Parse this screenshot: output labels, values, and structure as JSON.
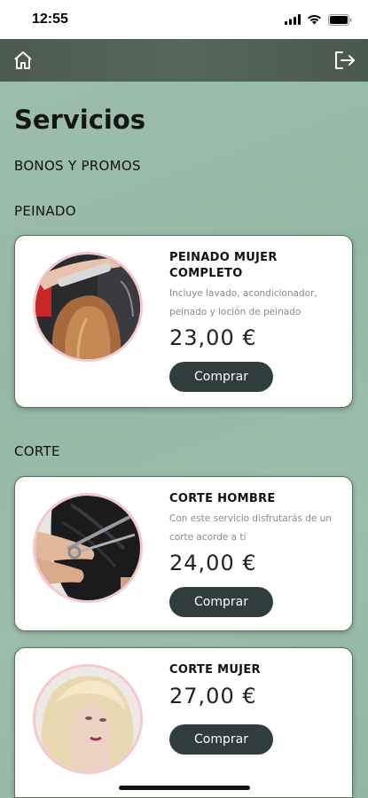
{
  "status": {
    "time": "12:55"
  },
  "page": {
    "title": "Servicios"
  },
  "sections": {
    "bonos": "BONOS Y PROMOS",
    "peinado": "PEINADO",
    "corte": "CORTE"
  },
  "services": [
    {
      "name": "PEINADO MUJER COMPLETO",
      "description": "Incluye lavado, acondicionador, peinado y loción de peinado",
      "price": "23,00 €",
      "button": "Comprar",
      "image": "hair-styling-photo"
    },
    {
      "name": "CORTE HOMBRE",
      "description": "Con este servicio disfrutarás de un corte acorde a ti",
      "price": "24,00 €",
      "button": "Comprar",
      "image": "haircut-scissors-photo"
    },
    {
      "name": "CORTE MUJER",
      "description": "",
      "price": "27,00 €",
      "button": "Comprar",
      "image": "blonde-woman-portrait-photo"
    }
  ],
  "icons": {
    "home": "home-icon",
    "logout": "logout-icon",
    "signal": "signal-icon",
    "wifi": "wifi-icon",
    "battery": "battery-icon"
  },
  "colors": {
    "background": "#9cbdab",
    "header": "#4f5f53",
    "button": "#2f3d3c",
    "photo_border": "#f3c9cf"
  }
}
